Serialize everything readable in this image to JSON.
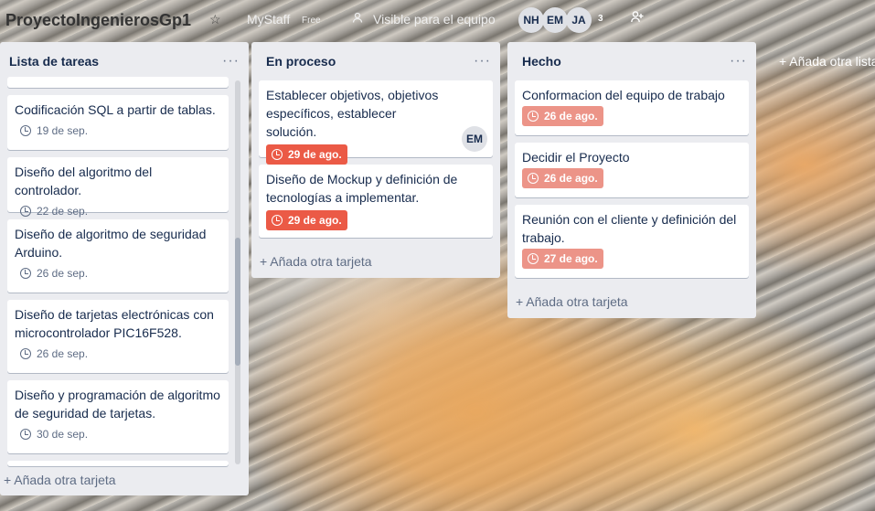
{
  "header": {
    "board_title": "ProyectoIngenierosGp1",
    "star_icon": "☆",
    "team_name": "MyStaff",
    "team_plan": "Free",
    "visibility_icon": "person-icon",
    "visibility_label": "Visible para el equipo",
    "members": [
      "NH",
      "EM",
      "JA"
    ],
    "member_count": "3",
    "invite_icon": "add-member-icon"
  },
  "lists": [
    {
      "title": "Lista de tareas",
      "menu": "···",
      "cards": [
        {
          "title": "Codificación SQL a partir de tablas.",
          "due": "19 de sep."
        },
        {
          "title": "Diseño del algoritmo del controlador.",
          "due": "22 de sep."
        },
        {
          "title": "Diseño de algoritmo de seguridad Arduino.",
          "due": "26 de sep."
        },
        {
          "title": "Diseño de tarjetas electrónicas con microcontrolador PIC16F528.",
          "due": "26 de sep."
        },
        {
          "title": "Diseño y programación de algoritmo de seguridad de tarjetas.",
          "due": "30 de sep."
        }
      ],
      "add_card": "+ Añada otra tarjeta"
    },
    {
      "title": "En proceso",
      "menu": "···",
      "cards": [
        {
          "title": "Establecer objetivos, objetivos específicos, establecer solución.",
          "due": "29 de ago.",
          "member": "EM"
        },
        {
          "title": "Diseño de Mockup y definición de tecnologías a implementar.",
          "due": "29 de ago."
        }
      ],
      "add_card": "+ Añada otra tarjeta"
    },
    {
      "title": "Hecho",
      "menu": "···",
      "cards": [
        {
          "title": "Conformacion del equipo de trabajo",
          "due": "26 de ago."
        },
        {
          "title": "Decidir el Proyecto",
          "due": "26 de ago."
        },
        {
          "title": "Reunión con el cliente y definición del trabajo.",
          "due": "27 de ago."
        }
      ],
      "add_card": "+ Añada otra tarjeta"
    }
  ],
  "add_list": "+ Añada otra lista",
  "colors": {
    "list_bg": "#ebecf0",
    "due_overdue": "#eb5a46",
    "due_done": "#ec9488"
  }
}
